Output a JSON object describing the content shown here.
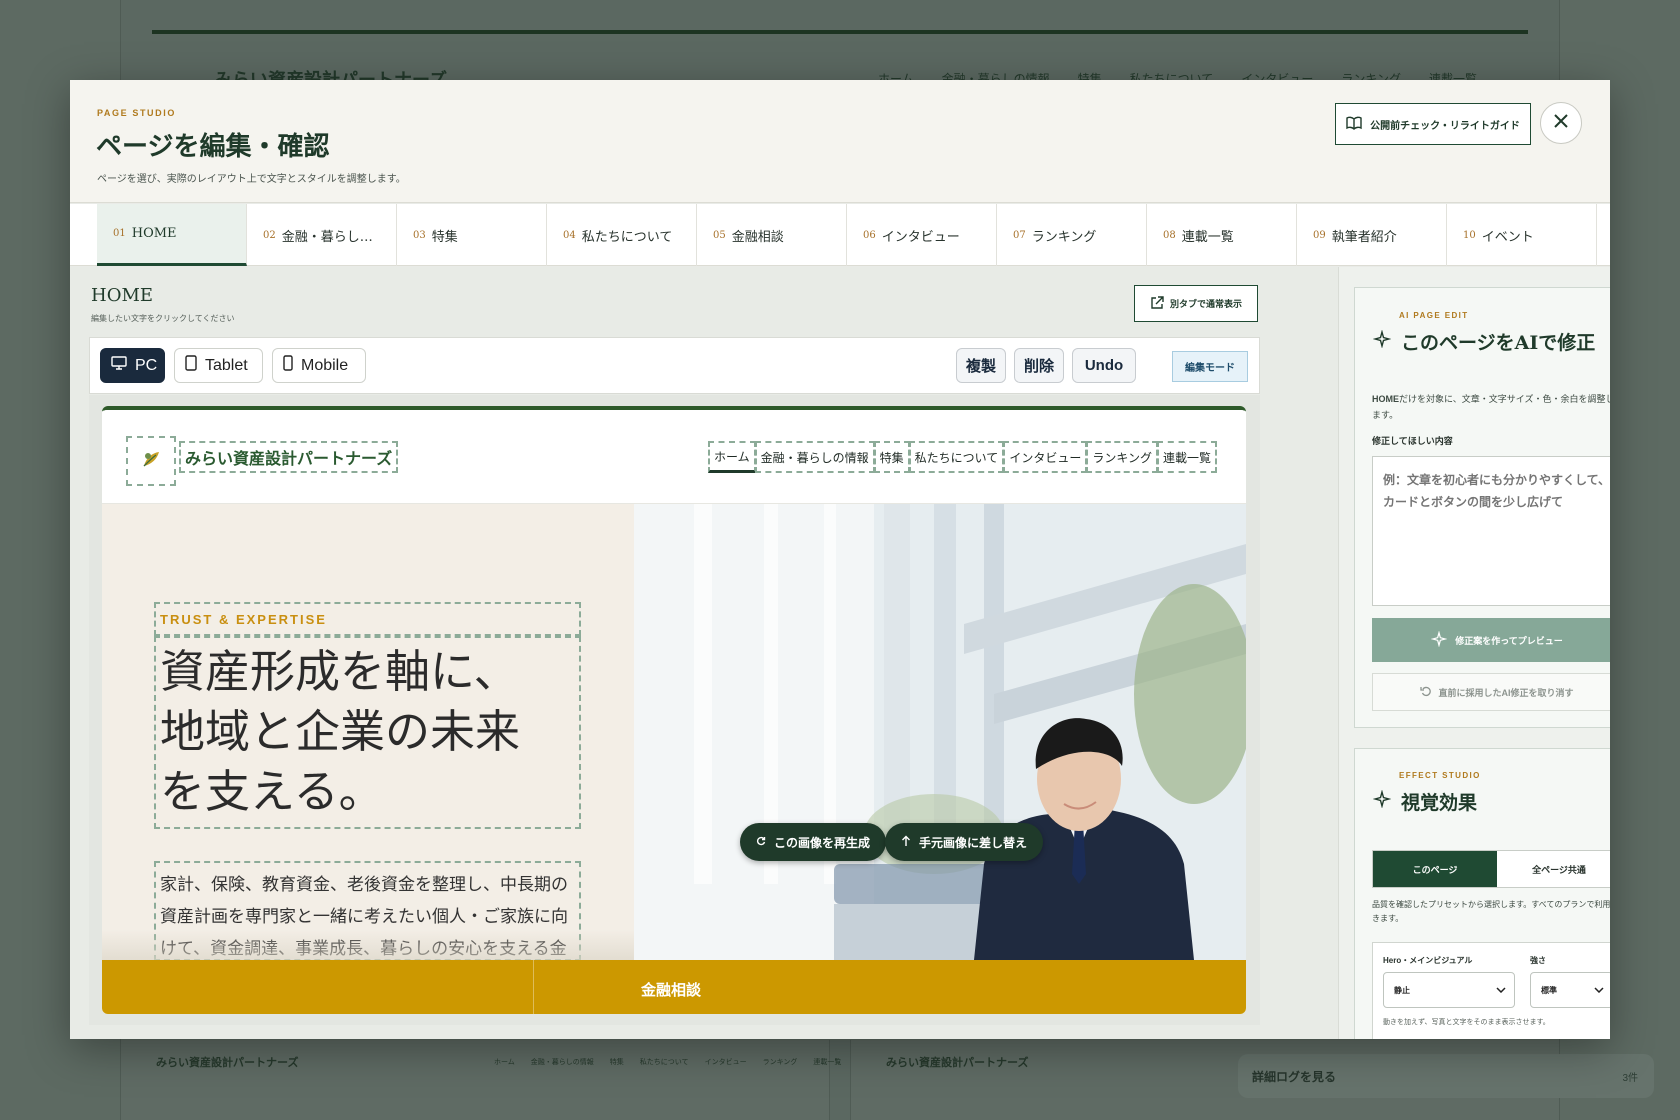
{
  "background": {
    "brand": "みらい資産設計パートナーズ",
    "nav": [
      "ホーム",
      "金融・暮らしの情報",
      "特集",
      "私たちについて",
      "インタビュー",
      "ランキング",
      "連載一覧"
    ],
    "footer_brand_left": "みらい資産設計パートナーズ",
    "footer_brand_right": "みらい資産設計パートナーズ",
    "footer_nav": [
      "ホーム",
      "金融・暮らしの情報",
      "特集",
      "私たちについて",
      "インタビュー",
      "ランキング",
      "連載一覧"
    ],
    "log_label": "詳細ログを見る",
    "log_count": "3件"
  },
  "modal": {
    "eyebrow": "PAGE STUDIO",
    "title": "ページを編集・確認",
    "subtitle": "ページを選び、実際のレイアウト上で文字とスタイルを調整します。",
    "guide_button": "公開前チェック・リライトガイド",
    "close_icon": "close-icon"
  },
  "tabs": [
    {
      "num": "01",
      "label": "HOME"
    },
    {
      "num": "02",
      "label": "金融・暮らし…"
    },
    {
      "num": "03",
      "label": "特集"
    },
    {
      "num": "04",
      "label": "私たちについて"
    },
    {
      "num": "05",
      "label": "金融相談"
    },
    {
      "num": "06",
      "label": "インタビュー"
    },
    {
      "num": "07",
      "label": "ランキング"
    },
    {
      "num": "08",
      "label": "連載一覧"
    },
    {
      "num": "09",
      "label": "執筆者紹介"
    },
    {
      "num": "10",
      "label": "イベント"
    }
  ],
  "editor": {
    "page_title": "HOME",
    "page_hint": "編集したい文字をクリックしてください",
    "open_new_tab": "別タブで通常表示",
    "devices": [
      "PC",
      "Tablet",
      "Mobile"
    ],
    "actions": {
      "duplicate": "複製",
      "delete": "削除",
      "undo": "Undo"
    },
    "mode": "編集モード"
  },
  "site": {
    "brand": "みらい資産設計パートナーズ",
    "nav": [
      "ホーム",
      "金融・暮らしの情報",
      "特集",
      "私たちについて",
      "インタビュー",
      "ランキング",
      "連載一覧"
    ],
    "kicker": "TRUST & EXPERTISE",
    "headline_lines": [
      "資産形成を軸に、",
      "地域と企業の未来",
      "を支える。"
    ],
    "lead": "家計、保険、教育資金、老後資金を整理し、中長期の資産計画を専門家と一緒に考えたい個人・ご家族に向けて、資金調達、事業成長、暮らしの安心を支える金",
    "image_regenerate": "この画像を再生成",
    "image_replace": "手元画像に差し替え",
    "cta": "金融相談",
    "accent": "#cc9800"
  },
  "ai_panel": {
    "eyebrow": "AI PAGE EDIT",
    "title": "このページをAIで修正",
    "desc_bold": "HOME",
    "desc": "だけを対象に、文章・文字サイズ・色・余白を調整します。",
    "label": "修正してほしい内容",
    "placeholder": "例：文章を初心者にも分かりやすくして、カードとボタンの間を少し広げて",
    "primary": "修正案を作ってプレビュー",
    "secondary": "直前に採用したAI修正を取り消す"
  },
  "effect_panel": {
    "eyebrow": "EFFECT STUDIO",
    "title": "視覚効果",
    "seg_on": "このページ",
    "seg_off": "全ページ共通",
    "desc": "品質を確認したプリセットから選択します。すべてのプランで利用できます。",
    "hero_label": "Hero・メインビジュアル",
    "hero_value": "静止",
    "strength_label": "強さ",
    "strength_value": "標準",
    "note": "動きを加えず、写真と文字をそのまま表示させます。"
  }
}
